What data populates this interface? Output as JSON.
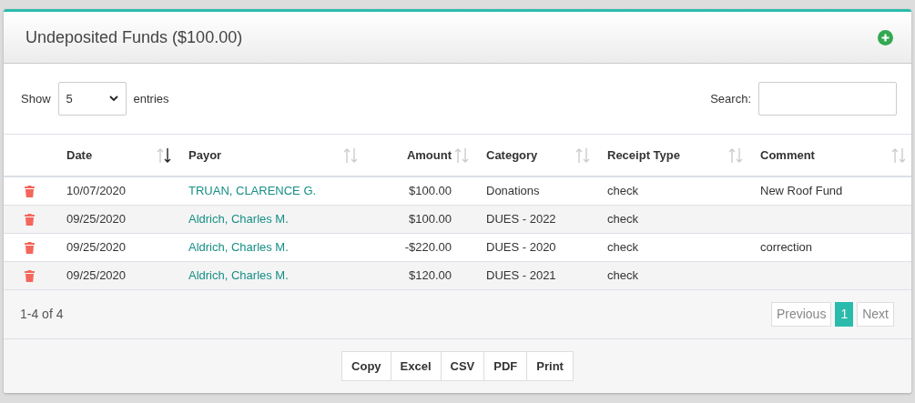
{
  "panel": {
    "title": "Undeposited Funds ($100.00)"
  },
  "length_control": {
    "label_before": "Show",
    "value": "5",
    "label_after": "entries"
  },
  "search": {
    "label": "Search:"
  },
  "table": {
    "columns": [
      {
        "label": "Date",
        "sorted": true,
        "numeric": false
      },
      {
        "label": "Payor",
        "sorted": false,
        "numeric": false
      },
      {
        "label": "Amount",
        "sorted": false,
        "numeric": true
      },
      {
        "label": "Category",
        "sorted": false,
        "numeric": false
      },
      {
        "label": "Receipt Type",
        "sorted": false,
        "numeric": false
      },
      {
        "label": "Comment",
        "sorted": false,
        "numeric": false
      }
    ],
    "rows": [
      {
        "date": "10/07/2020",
        "payor": "TRUAN, CLARENCE G.",
        "amount": "$100.00",
        "category": "Donations",
        "receipt_type": "check",
        "comment": "New Roof Fund"
      },
      {
        "date": "09/25/2020",
        "payor": "Aldrich, Charles M.",
        "amount": "$100.00",
        "category": "DUES - 2022",
        "receipt_type": "check"
      },
      {
        "date": "09/25/2020",
        "payor": "Aldrich, Charles M.",
        "amount": "-$220.00",
        "category": "DUES - 2020",
        "receipt_type": "check",
        "comment": "correction"
      },
      {
        "date": "09/25/2020",
        "payor": "Aldrich, Charles M.",
        "amount": "$120.00",
        "category": "DUES - 2021",
        "receipt_type": "check"
      }
    ]
  },
  "info": "1-4 of 4",
  "pagination": [
    {
      "label": "Previous",
      "selected": false
    },
    {
      "label": "1",
      "selected": true
    },
    {
      "label": "Next",
      "selected": false
    }
  ],
  "export_buttons": [
    "Copy",
    "Excel",
    "CSV",
    "PDF",
    "Print"
  ]
}
